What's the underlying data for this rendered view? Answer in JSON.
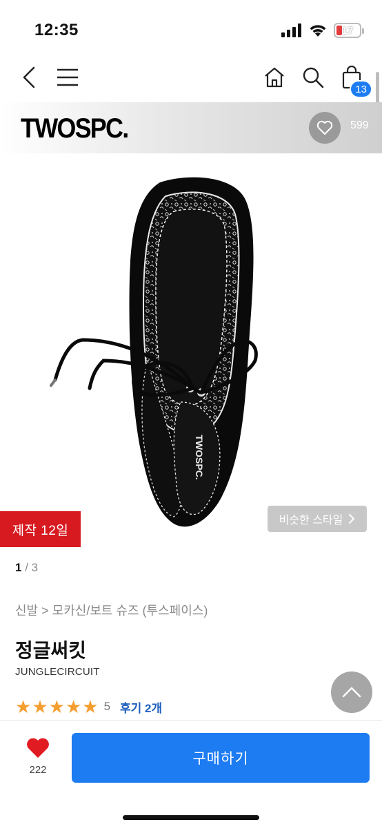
{
  "status_bar": {
    "time": "12:35",
    "battery": "17"
  },
  "nav": {
    "cart_count": "13"
  },
  "brand": {
    "name": "TWOSPC.",
    "like_count": "599"
  },
  "product_image": {
    "insole_logo": "TWOSPC."
  },
  "badges": {
    "made_days": "제작 12일",
    "similar_style": "비슷한 스타일"
  },
  "gallery": {
    "current": "1",
    "separator": " / ",
    "total": "3"
  },
  "breadcrumb": "신발 > 모카신/보트 슈즈 (투스페이스)",
  "product": {
    "title": "정글써킷",
    "subtitle": "JUNGLECIRCUIT",
    "rating": 5,
    "rating_text": "5",
    "review_link": "후기 2개"
  },
  "bottom": {
    "wish_count": "222",
    "buy_label": "구매하기"
  },
  "colors": {
    "accent": "#1d7cf2",
    "badge_red": "#d71920",
    "star": "#f59e30",
    "review_link": "#1f5fbf"
  }
}
